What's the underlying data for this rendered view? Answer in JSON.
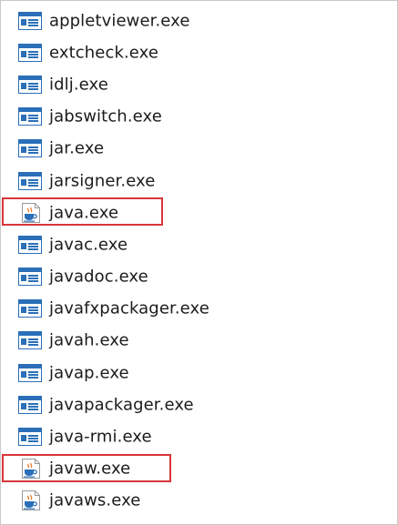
{
  "files": [
    {
      "name": "appletviewer.exe",
      "icon": "console-exe-icon"
    },
    {
      "name": "extcheck.exe",
      "icon": "console-exe-icon"
    },
    {
      "name": "idlj.exe",
      "icon": "console-exe-icon"
    },
    {
      "name": "jabswitch.exe",
      "icon": "console-exe-icon"
    },
    {
      "name": "jar.exe",
      "icon": "console-exe-icon"
    },
    {
      "name": "jarsigner.exe",
      "icon": "console-exe-icon"
    },
    {
      "name": "java.exe",
      "icon": "java-coffee-cup-icon",
      "highlighted": true
    },
    {
      "name": "javac.exe",
      "icon": "console-exe-icon"
    },
    {
      "name": "javadoc.exe",
      "icon": "console-exe-icon"
    },
    {
      "name": "javafxpackager.exe",
      "icon": "console-exe-icon"
    },
    {
      "name": "javah.exe",
      "icon": "console-exe-icon"
    },
    {
      "name": "javap.exe",
      "icon": "console-exe-icon"
    },
    {
      "name": "javapackager.exe",
      "icon": "console-exe-icon"
    },
    {
      "name": "java-rmi.exe",
      "icon": "console-exe-icon"
    },
    {
      "name": "javaw.exe",
      "icon": "java-coffee-cup-icon",
      "highlighted": true
    },
    {
      "name": "javaws.exe",
      "icon": "java-coffee-cup-icon"
    }
  ],
  "colors": {
    "highlight_border": "#d9353b",
    "icon_blue": "#2a6fb8",
    "text": "#1b1b1b"
  }
}
